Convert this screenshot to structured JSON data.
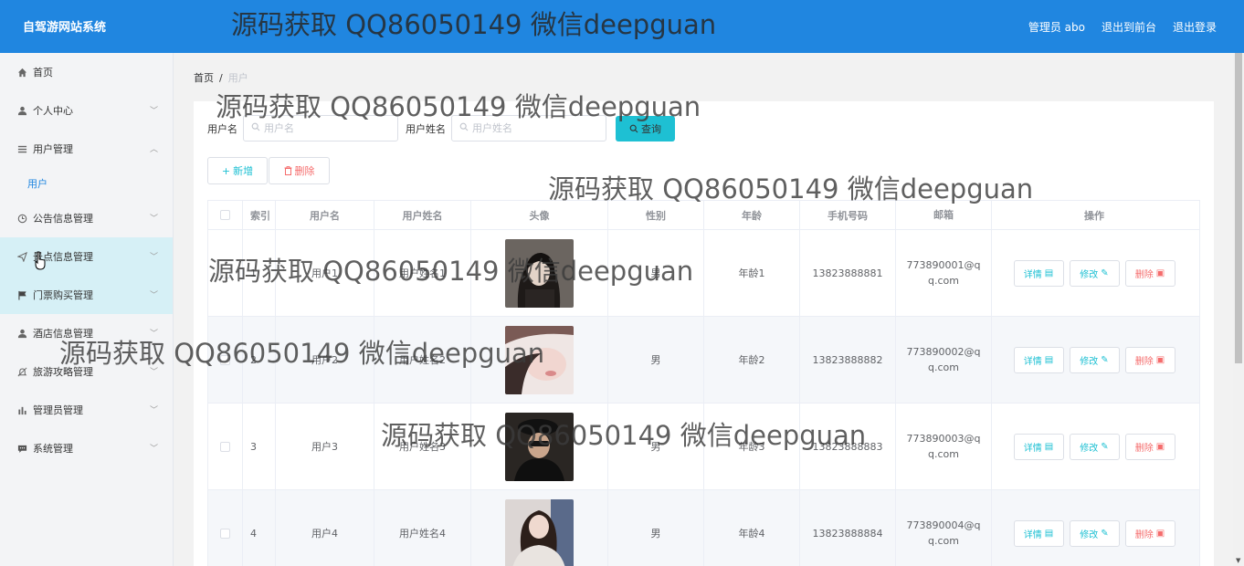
{
  "header": {
    "brand": "自驾游网站系统",
    "links": [
      "管理员 abo",
      "退出到前台",
      "退出登录"
    ]
  },
  "sidebar": {
    "items": [
      {
        "label": "首页",
        "icon": "home-icon",
        "chevron": ""
      },
      {
        "label": "个人中心",
        "icon": "user-icon",
        "chevron": "﹀"
      },
      {
        "label": "用户管理",
        "icon": "list-icon",
        "chevron": "︿"
      },
      {
        "label": "公告信息管理",
        "icon": "clock-icon",
        "chevron": "﹀"
      },
      {
        "label": "景点信息管理",
        "icon": "send-icon",
        "chevron": "﹀"
      },
      {
        "label": "门票购买管理",
        "icon": "flag-icon",
        "chevron": "﹀"
      },
      {
        "label": "酒店信息管理",
        "icon": "user-icon",
        "chevron": "﹀"
      },
      {
        "label": "旅游攻略管理",
        "icon": "bell-icon",
        "chevron": "﹀"
      },
      {
        "label": "管理员管理",
        "icon": "chart-icon",
        "chevron": "﹀"
      },
      {
        "label": "系统管理",
        "icon": "chat-icon",
        "chevron": "﹀"
      }
    ],
    "submenu": [
      "用户"
    ]
  },
  "breadcrumb": {
    "home": "首页",
    "separator": "/",
    "current": "用户"
  },
  "search": {
    "label_username": "用户名",
    "placeholder_username": "用户名",
    "label_name": "用户姓名",
    "placeholder_name": "用户姓名",
    "query_label": "查询"
  },
  "actions": {
    "add_label": "新增",
    "delete_label": "删除"
  },
  "table": {
    "headers": [
      "索引",
      "用户名",
      "用户姓名",
      "头像",
      "性别",
      "年龄",
      "手机号码",
      "邮箱",
      "操作"
    ],
    "rows": [
      {
        "index": "1",
        "username": "用户1",
        "name": "用户姓名1",
        "gender": "男",
        "age": "年龄1",
        "phone": "13823888881",
        "email": "773890001@qq.com"
      },
      {
        "index": "2",
        "username": "用户2",
        "name": "用户姓名2",
        "gender": "男",
        "age": "年龄2",
        "phone": "13823888882",
        "email": "773890002@qq.com"
      },
      {
        "index": "3",
        "username": "用户3",
        "name": "用户姓名3",
        "gender": "男",
        "age": "年龄3",
        "phone": "13823888883",
        "email": "773890003@qq.com"
      },
      {
        "index": "4",
        "username": "用户4",
        "name": "用户姓名4",
        "gender": "男",
        "age": "年龄4",
        "phone": "13823888884",
        "email": "773890004@qq.com"
      }
    ],
    "op_labels": {
      "detail": "详情",
      "edit": "修改",
      "delete": "删除"
    }
  },
  "watermark": "源码获取 QQ86050149 微信deepguan",
  "colors": {
    "header": "#2086e0",
    "accent": "#1ec0d3",
    "danger": "#f56c6c",
    "sidebar_highlight": "#d6f0f6"
  }
}
